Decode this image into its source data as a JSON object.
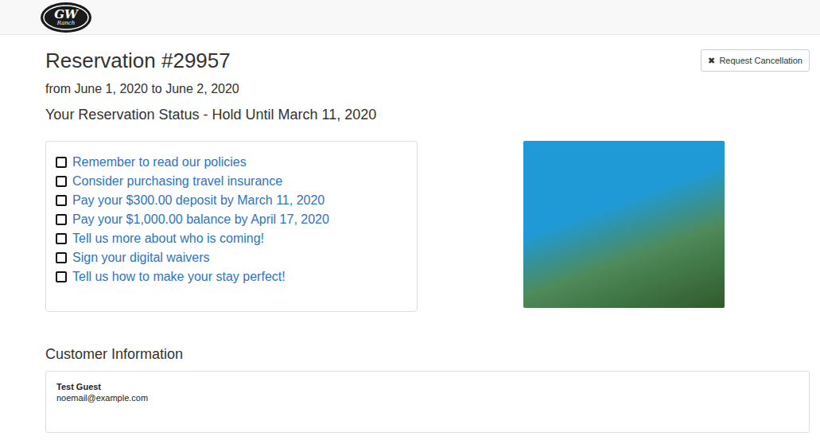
{
  "logo": {
    "text": "GW",
    "subtext": "Ranch"
  },
  "reservation": {
    "title": "Reservation #29957",
    "dates": "from June 1, 2020 to June 2, 2020",
    "cancel_button": {
      "icon": "✖",
      "label": "Request Cancellation"
    }
  },
  "status": {
    "heading": "Your Reservation Status - Hold Until March 11, 2020",
    "items": [
      {
        "label": "Remember to read our policies",
        "checked": false
      },
      {
        "label": "Consider purchasing travel insurance",
        "checked": false
      },
      {
        "label": "Pay your $300.00 deposit by March 11, 2020",
        "checked": false
      },
      {
        "label": "Pay your $1,000.00 balance by April 17, 2020",
        "checked": false
      },
      {
        "label": "Tell us more about who is coming!",
        "checked": false
      },
      {
        "label": "Sign your digital waivers",
        "checked": false
      },
      {
        "label": "Tell us how to make your stay perfect!",
        "checked": false
      }
    ]
  },
  "customer": {
    "heading": "Customer Information",
    "name": "Test Guest",
    "email": "noemail@example.com"
  }
}
